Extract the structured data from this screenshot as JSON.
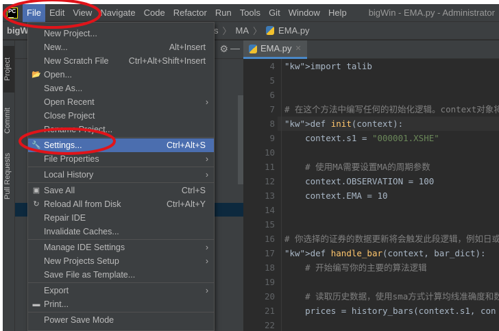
{
  "menubar": {
    "items": [
      "File",
      "Edit",
      "View",
      "Navigate",
      "Code",
      "Refactor",
      "Run",
      "Tools",
      "Git",
      "Window",
      "Help"
    ],
    "window_title": "bigWin - EMA.py - Administrator"
  },
  "navbar": {
    "project": "bigW",
    "crumbs": [
      "s",
      "MA",
      "EMA.py"
    ]
  },
  "toolwindows": {
    "project": "Project",
    "commit": "Commit",
    "pull_requests": "Pull Requests"
  },
  "editor": {
    "tab": "EMA.py",
    "lines": [
      {
        "n": "4",
        "t": "import talib"
      },
      {
        "n": "5",
        "t": ""
      },
      {
        "n": "6",
        "t": ""
      },
      {
        "n": "7",
        "t": "# 在这个方法中编写任何的初始化逻辑。context对象将"
      },
      {
        "n": "8",
        "t": "def init(context):"
      },
      {
        "n": "9",
        "t": "    context.s1 = \"000001.XSHE\""
      },
      {
        "n": "10",
        "t": ""
      },
      {
        "n": "11",
        "t": "    # 使用MA需要设置MA的周期参数"
      },
      {
        "n": "12",
        "t": "    context.OBSERVATION = 100"
      },
      {
        "n": "13",
        "t": "    context.EMA = 10"
      },
      {
        "n": "14",
        "t": ""
      },
      {
        "n": "15",
        "t": ""
      },
      {
        "n": "16",
        "t": "# 你选择的证券的数据更新将会触发此段逻辑，例如日或"
      },
      {
        "n": "17",
        "t": "def handle_bar(context, bar_dict):"
      },
      {
        "n": "18",
        "t": "    # 开始编写你的主要的算法逻辑"
      },
      {
        "n": "19",
        "t": ""
      },
      {
        "n": "20",
        "t": "    # 读取历史数据，使用sma方式计算均线准确度和数"
      },
      {
        "n": "21",
        "t": "    prices = history_bars(context.s1, con"
      },
      {
        "n": "22",
        "t": ""
      }
    ]
  },
  "file_menu": [
    {
      "label": "New Project..."
    },
    {
      "label": "New...",
      "shortcut": "Alt+Insert"
    },
    {
      "label": "New Scratch File",
      "shortcut": "Ctrl+Alt+Shift+Insert"
    },
    {
      "label": "Open...",
      "icon": "folder-icon"
    },
    {
      "label": "Save As..."
    },
    {
      "label": "Open Recent",
      "submenu": true
    },
    {
      "label": "Close Project"
    },
    {
      "label": "Rename Project..."
    },
    {
      "label": "Settings...",
      "shortcut": "Ctrl+Alt+S",
      "icon": "wrench-icon",
      "highlighted": true,
      "sep": true
    },
    {
      "label": "File Properties",
      "submenu": true
    },
    {
      "label": "Local History",
      "submenu": true,
      "sep": true
    },
    {
      "label": "Save All",
      "shortcut": "Ctrl+S",
      "icon": "save-icon",
      "sep": true
    },
    {
      "label": "Reload All from Disk",
      "shortcut": "Ctrl+Alt+Y",
      "icon": "reload-icon"
    },
    {
      "label": "Repair IDE"
    },
    {
      "label": "Invalidate Caches..."
    },
    {
      "label": "Manage IDE Settings",
      "submenu": true,
      "sep": true
    },
    {
      "label": "New Projects Setup",
      "submenu": true
    },
    {
      "label": "Save File as Template..."
    },
    {
      "label": "Export",
      "submenu": true,
      "sep": true
    },
    {
      "label": "Print...",
      "icon": "print-icon"
    },
    {
      "label": "Power Save Mode",
      "sep": true
    }
  ]
}
